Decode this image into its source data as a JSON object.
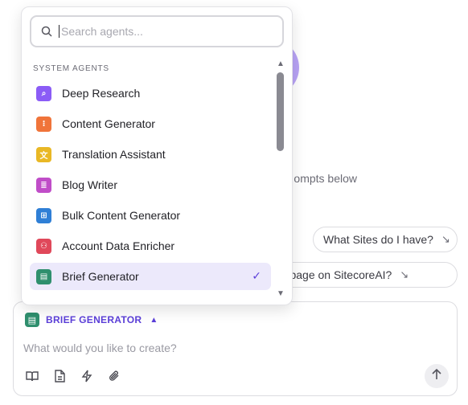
{
  "background": {
    "subtitle": "ompts below",
    "suggestions": [
      {
        "label": "What Sites do I have?",
        "icon": "arrow-down-right-icon"
      },
      {
        "label": "reate a page on SitecoreAI?",
        "icon": "arrow-down-right-icon"
      }
    ]
  },
  "dropdown": {
    "search_placeholder": "Search agents...",
    "section_label": "SYSTEM AGENTS",
    "items": [
      {
        "label": "Deep Research",
        "color": "#8b5cf6",
        "glyph": "⌕"
      },
      {
        "label": "Content Generator",
        "color": "#f0743a",
        "glyph": "⁝"
      },
      {
        "label": "Translation Assistant",
        "color": "#e9b825",
        "glyph": "文"
      },
      {
        "label": "Blog Writer",
        "color": "#c04dc8",
        "glyph": "≣"
      },
      {
        "label": "Bulk Content Generator",
        "color": "#2f7fd6",
        "glyph": "⊞"
      },
      {
        "label": "Account Data Enricher",
        "color": "#e0485a",
        "glyph": "⚇"
      },
      {
        "label": "Brief Generator",
        "color": "#2f8f6e",
        "glyph": "▤",
        "selected": true
      }
    ]
  },
  "composer": {
    "agent_name": "BRIEF GENERATOR",
    "placeholder": "What would you like to create?",
    "tools": [
      "book-icon",
      "document-icon",
      "lightning-icon",
      "paperclip-icon"
    ],
    "send_icon": "arrow-up-icon"
  }
}
